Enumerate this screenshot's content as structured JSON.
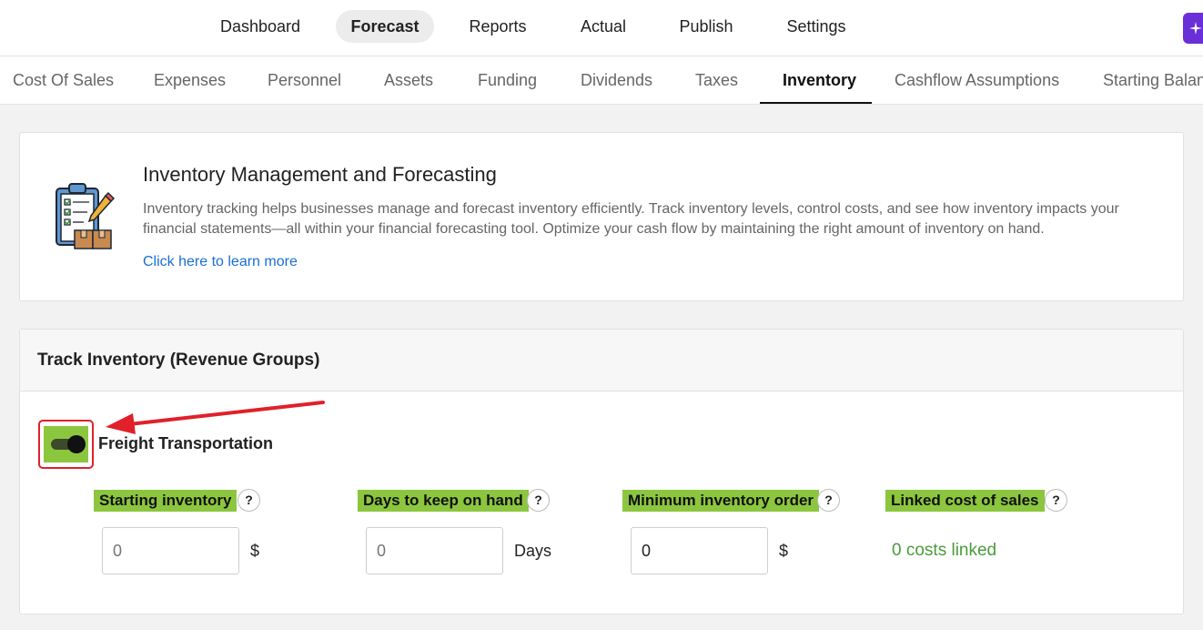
{
  "top_nav": {
    "tabs": [
      {
        "label": "Dashboard"
      },
      {
        "label": "Forecast",
        "active": true
      },
      {
        "label": "Reports"
      },
      {
        "label": "Actual"
      },
      {
        "label": "Publish"
      },
      {
        "label": "Settings"
      }
    ],
    "action_icon": "sparkle-icon"
  },
  "sub_nav": {
    "tabs": [
      {
        "label": "Cost Of Sales"
      },
      {
        "label": "Expenses"
      },
      {
        "label": "Personnel"
      },
      {
        "label": "Assets"
      },
      {
        "label": "Funding"
      },
      {
        "label": "Dividends"
      },
      {
        "label": "Taxes"
      },
      {
        "label": "Inventory",
        "active": true
      },
      {
        "label": "Cashflow Assumptions"
      },
      {
        "label": "Starting Balan"
      }
    ]
  },
  "info_card": {
    "icon": "clipboard-boxes-icon",
    "title": "Inventory Management and Forecasting",
    "description": "Inventory tracking helps businesses manage and forecast inventory efficiently. Track inventory levels, control costs, and see how inventory impacts your financial statements—all within your financial forecasting tool. Optimize your cash flow by maintaining the right amount of inventory on hand.",
    "link": "Click here to learn more"
  },
  "track_card": {
    "title": "Track Inventory (Revenue Groups)",
    "group": {
      "name": "Freight Transportation",
      "enabled": true
    },
    "fields": [
      {
        "label": "Starting inventory",
        "help": "?",
        "value": "",
        "placeholder": "0",
        "unit": "$"
      },
      {
        "label": "Days to keep on hand",
        "help": "?",
        "value": "",
        "placeholder": "0",
        "unit": "Days"
      },
      {
        "label": "Minimum inventory order",
        "help": "?",
        "value": "0",
        "placeholder": "0",
        "unit": "$"
      },
      {
        "label": "Linked cost of sales",
        "help": "?",
        "linked_text": "0 costs linked"
      }
    ]
  },
  "colors": {
    "highlight_green": "#8cc63f",
    "annotation_red": "#e0202a",
    "link_blue": "#1a6fd1",
    "linked_green": "#4a9b3a",
    "brand_purple": "#6a2fd6"
  }
}
